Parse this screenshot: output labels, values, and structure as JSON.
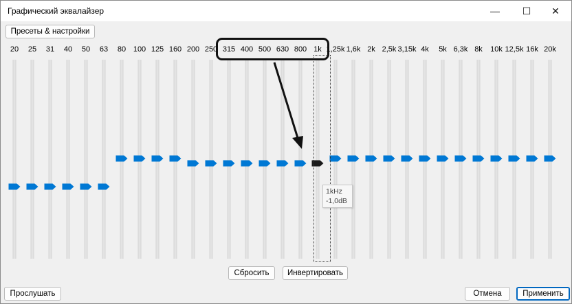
{
  "window": {
    "title": "Графический эквалайзер"
  },
  "controls": {
    "minimize": "—",
    "maximize": "☐",
    "close": "✕"
  },
  "toolbar": {
    "presets_label": "Пресеты & настройки"
  },
  "bands": [
    {
      "label": "20",
      "level": -1
    },
    {
      "label": "25",
      "level": -1
    },
    {
      "label": "31",
      "level": -1
    },
    {
      "label": "40",
      "level": -1
    },
    {
      "label": "50",
      "level": -1
    },
    {
      "label": "63",
      "level": -1
    },
    {
      "label": "80",
      "level": 1
    },
    {
      "label": "100",
      "level": 1
    },
    {
      "label": "125",
      "level": 1
    },
    {
      "label": "160",
      "level": 1
    },
    {
      "label": "200",
      "level": 0
    },
    {
      "label": "250",
      "level": 0
    },
    {
      "label": "315",
      "level": 0
    },
    {
      "label": "400",
      "level": 0
    },
    {
      "label": "500",
      "level": 0
    },
    {
      "label": "630",
      "level": 0
    },
    {
      "label": "800",
      "level": 0
    },
    {
      "label": "1k",
      "level": 0,
      "selected": true
    },
    {
      "label": "1,25k",
      "level": 1
    },
    {
      "label": "1,6k",
      "level": 1
    },
    {
      "label": "2k",
      "level": 1
    },
    {
      "label": "2,5k",
      "level": 1
    },
    {
      "label": "3,15k",
      "level": 1
    },
    {
      "label": "4k",
      "level": 1
    },
    {
      "label": "5k",
      "level": 1
    },
    {
      "label": "6,3k",
      "level": 1
    },
    {
      "label": "8k",
      "level": 1
    },
    {
      "label": "10k",
      "level": 1
    },
    {
      "label": "12,5k",
      "level": 1
    },
    {
      "label": "16k",
      "level": 1
    },
    {
      "label": "20k",
      "level": 1
    }
  ],
  "tooltip": {
    "line1": "1kHz",
    "line2": "-1,0dB"
  },
  "buttons": {
    "reset": "Сбросить",
    "invert": "Инвертировать",
    "listen": "Прослушать",
    "cancel": "Отмена",
    "apply": "Применить"
  },
  "colors": {
    "thumb": "#0078d4",
    "thumb_selected": "#1a1a1a",
    "annotation": "#111111"
  }
}
